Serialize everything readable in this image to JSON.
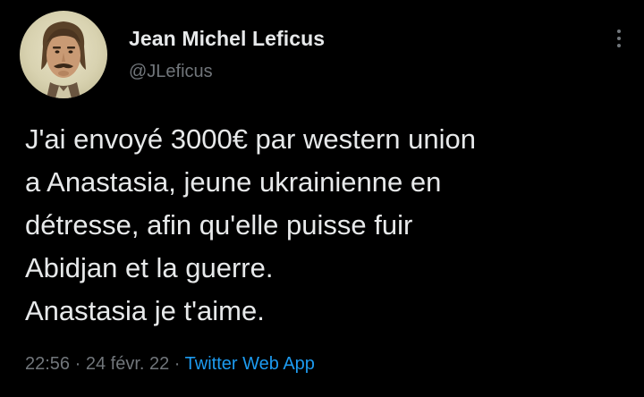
{
  "author": {
    "name": "Jean Michel Leficus",
    "handle": "@JLeficus"
  },
  "tweet": {
    "lines": [
      "J'ai envoyé 3000€ par western union",
      "a Anastasia, jeune ukrainienne en",
      "détresse, afin qu'elle puisse fuir",
      "Abidjan et la guerre.",
      "Anastasia je t'aime."
    ]
  },
  "meta": {
    "time": "22:56",
    "separator": " · ",
    "date": "24 févr. 22",
    "source": "Twitter Web App"
  },
  "icons": {
    "more": "more-vertical-icon",
    "avatar": "avatar"
  },
  "colors": {
    "background": "#000000",
    "text": "#e7e9ea",
    "secondary": "#71767b",
    "link": "#1d9bf0"
  }
}
